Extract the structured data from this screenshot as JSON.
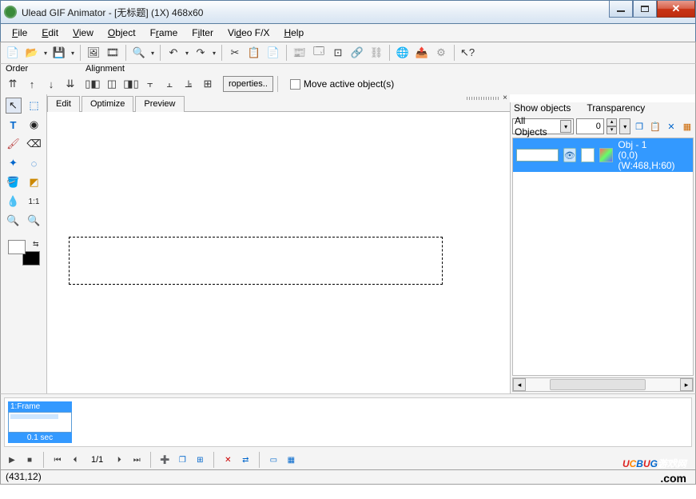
{
  "window": {
    "title": "Ulead GIF Animator - [无标题] (1X) 468x60"
  },
  "menu": {
    "file": "File",
    "edit": "Edit",
    "view": "View",
    "object": "Object",
    "frame": "Frame",
    "filter": "Filter",
    "videofx": "Video F/X",
    "help": "Help"
  },
  "orderbar": {
    "order_label": "Order",
    "alignment_label": "Alignment",
    "properties_btn": "roperties..",
    "move_active": "Move active object(s)"
  },
  "tabs": {
    "edit": "Edit",
    "optimize": "Optimize",
    "preview": "Preview"
  },
  "objects_panel": {
    "show_label": "Show objects",
    "trans_label": "Transparency",
    "show_value": "All Objects",
    "trans_value": "0",
    "item_name": "Obj - 1",
    "item_coords": "(0,0)(W:468,H:60)"
  },
  "frames": {
    "hdr": "1:Frame",
    "time": "0.1 sec",
    "count": "1/1"
  },
  "status": {
    "coord": "(431,12)"
  },
  "watermark": {
    "text": "UCBUG",
    "han": "游戏网",
    "com": ".com"
  }
}
